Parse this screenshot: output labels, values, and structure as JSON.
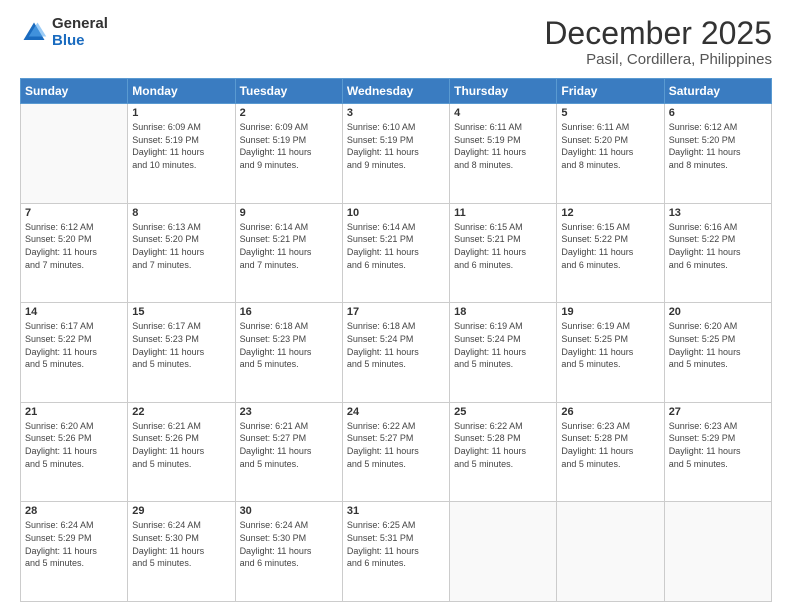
{
  "header": {
    "logo_general": "General",
    "logo_blue": "Blue",
    "title": "December 2025",
    "subtitle": "Pasil, Cordillera, Philippines"
  },
  "calendar": {
    "headers": [
      "Sunday",
      "Monday",
      "Tuesday",
      "Wednesday",
      "Thursday",
      "Friday",
      "Saturday"
    ],
    "weeks": [
      [
        {
          "day": "",
          "info": ""
        },
        {
          "day": "1",
          "info": "Sunrise: 6:09 AM\nSunset: 5:19 PM\nDaylight: 11 hours\nand 10 minutes."
        },
        {
          "day": "2",
          "info": "Sunrise: 6:09 AM\nSunset: 5:19 PM\nDaylight: 11 hours\nand 9 minutes."
        },
        {
          "day": "3",
          "info": "Sunrise: 6:10 AM\nSunset: 5:19 PM\nDaylight: 11 hours\nand 9 minutes."
        },
        {
          "day": "4",
          "info": "Sunrise: 6:11 AM\nSunset: 5:19 PM\nDaylight: 11 hours\nand 8 minutes."
        },
        {
          "day": "5",
          "info": "Sunrise: 6:11 AM\nSunset: 5:20 PM\nDaylight: 11 hours\nand 8 minutes."
        },
        {
          "day": "6",
          "info": "Sunrise: 6:12 AM\nSunset: 5:20 PM\nDaylight: 11 hours\nand 8 minutes."
        }
      ],
      [
        {
          "day": "7",
          "info": "Sunrise: 6:12 AM\nSunset: 5:20 PM\nDaylight: 11 hours\nand 7 minutes."
        },
        {
          "day": "8",
          "info": "Sunrise: 6:13 AM\nSunset: 5:20 PM\nDaylight: 11 hours\nand 7 minutes."
        },
        {
          "day": "9",
          "info": "Sunrise: 6:14 AM\nSunset: 5:21 PM\nDaylight: 11 hours\nand 7 minutes."
        },
        {
          "day": "10",
          "info": "Sunrise: 6:14 AM\nSunset: 5:21 PM\nDaylight: 11 hours\nand 6 minutes."
        },
        {
          "day": "11",
          "info": "Sunrise: 6:15 AM\nSunset: 5:21 PM\nDaylight: 11 hours\nand 6 minutes."
        },
        {
          "day": "12",
          "info": "Sunrise: 6:15 AM\nSunset: 5:22 PM\nDaylight: 11 hours\nand 6 minutes."
        },
        {
          "day": "13",
          "info": "Sunrise: 6:16 AM\nSunset: 5:22 PM\nDaylight: 11 hours\nand 6 minutes."
        }
      ],
      [
        {
          "day": "14",
          "info": "Sunrise: 6:17 AM\nSunset: 5:22 PM\nDaylight: 11 hours\nand 5 minutes."
        },
        {
          "day": "15",
          "info": "Sunrise: 6:17 AM\nSunset: 5:23 PM\nDaylight: 11 hours\nand 5 minutes."
        },
        {
          "day": "16",
          "info": "Sunrise: 6:18 AM\nSunset: 5:23 PM\nDaylight: 11 hours\nand 5 minutes."
        },
        {
          "day": "17",
          "info": "Sunrise: 6:18 AM\nSunset: 5:24 PM\nDaylight: 11 hours\nand 5 minutes."
        },
        {
          "day": "18",
          "info": "Sunrise: 6:19 AM\nSunset: 5:24 PM\nDaylight: 11 hours\nand 5 minutes."
        },
        {
          "day": "19",
          "info": "Sunrise: 6:19 AM\nSunset: 5:25 PM\nDaylight: 11 hours\nand 5 minutes."
        },
        {
          "day": "20",
          "info": "Sunrise: 6:20 AM\nSunset: 5:25 PM\nDaylight: 11 hours\nand 5 minutes."
        }
      ],
      [
        {
          "day": "21",
          "info": "Sunrise: 6:20 AM\nSunset: 5:26 PM\nDaylight: 11 hours\nand 5 minutes."
        },
        {
          "day": "22",
          "info": "Sunrise: 6:21 AM\nSunset: 5:26 PM\nDaylight: 11 hours\nand 5 minutes."
        },
        {
          "day": "23",
          "info": "Sunrise: 6:21 AM\nSunset: 5:27 PM\nDaylight: 11 hours\nand 5 minutes."
        },
        {
          "day": "24",
          "info": "Sunrise: 6:22 AM\nSunset: 5:27 PM\nDaylight: 11 hours\nand 5 minutes."
        },
        {
          "day": "25",
          "info": "Sunrise: 6:22 AM\nSunset: 5:28 PM\nDaylight: 11 hours\nand 5 minutes."
        },
        {
          "day": "26",
          "info": "Sunrise: 6:23 AM\nSunset: 5:28 PM\nDaylight: 11 hours\nand 5 minutes."
        },
        {
          "day": "27",
          "info": "Sunrise: 6:23 AM\nSunset: 5:29 PM\nDaylight: 11 hours\nand 5 minutes."
        }
      ],
      [
        {
          "day": "28",
          "info": "Sunrise: 6:24 AM\nSunset: 5:29 PM\nDaylight: 11 hours\nand 5 minutes."
        },
        {
          "day": "29",
          "info": "Sunrise: 6:24 AM\nSunset: 5:30 PM\nDaylight: 11 hours\nand 5 minutes."
        },
        {
          "day": "30",
          "info": "Sunrise: 6:24 AM\nSunset: 5:30 PM\nDaylight: 11 hours\nand 6 minutes."
        },
        {
          "day": "31",
          "info": "Sunrise: 6:25 AM\nSunset: 5:31 PM\nDaylight: 11 hours\nand 6 minutes."
        },
        {
          "day": "",
          "info": ""
        },
        {
          "day": "",
          "info": ""
        },
        {
          "day": "",
          "info": ""
        }
      ]
    ]
  }
}
